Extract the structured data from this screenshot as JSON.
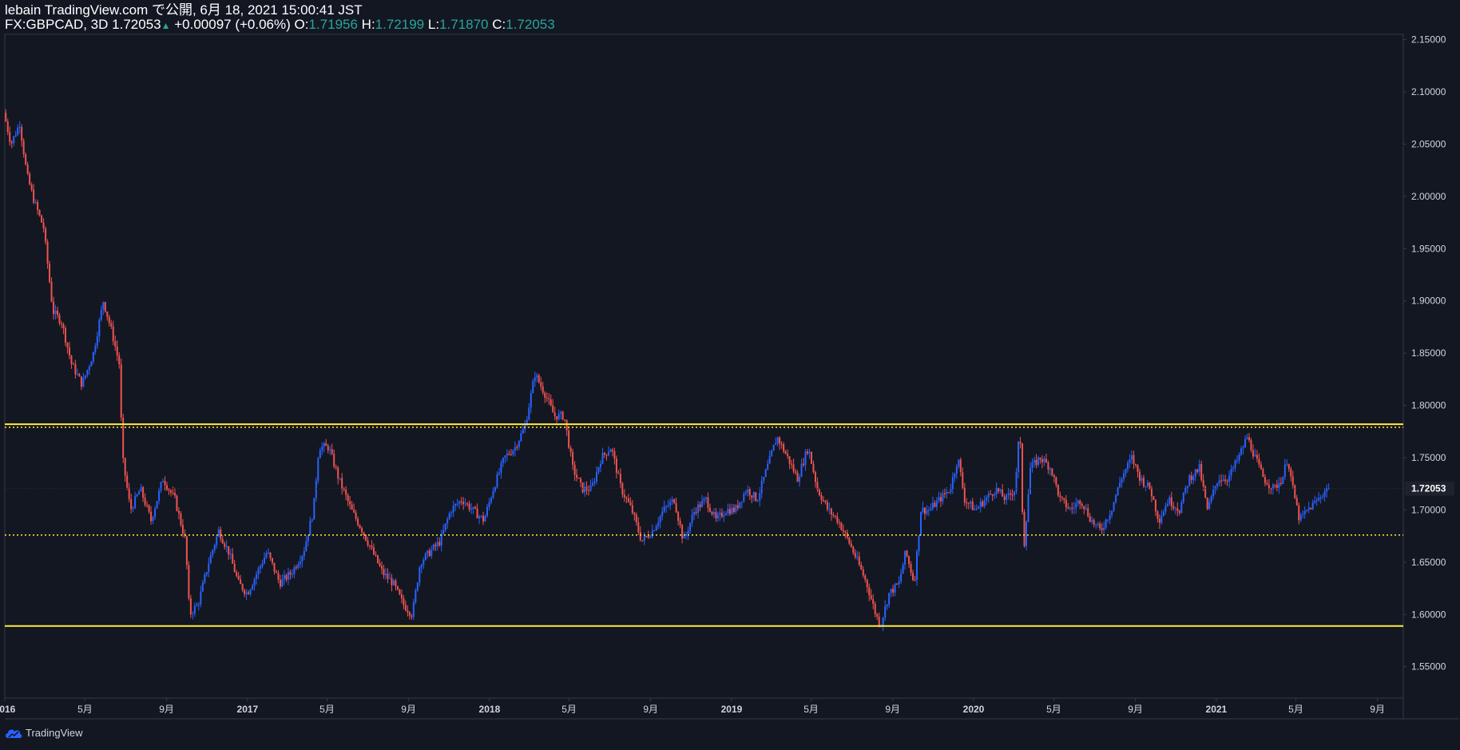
{
  "header": {
    "publish_text": "lebain TradingView.com で公開, 6月 18, 2021 15:00:41 JST",
    "symbol": "FX:GBPCAD, 3D",
    "last": "1.72053",
    "up_arrow": "▲",
    "change": "+0.00097 (+0.06%)",
    "o_label": "O:",
    "o_value": "1.71956",
    "h_label": "H:",
    "h_value": "1.72199",
    "l_label": "L:",
    "l_value": "1.71870",
    "c_label": "C:",
    "c_value": "1.72053"
  },
  "footer": {
    "brand": "TradingView",
    "logo_icon": "tradingview-cloud-icon"
  },
  "colors": {
    "background": "#131722",
    "up": "#2962ff",
    "down": "#ef5350",
    "level_line": "#ffeb3b",
    "axis_text": "#d1d4dc",
    "grid": "#363a45",
    "price_badge": "#1e222d"
  },
  "chart_data": {
    "type": "candlestick",
    "symbol": "FX:GBPCAD",
    "timeframe": "3D",
    "ylim": [
      1.52,
      2.155
    ],
    "y_ticks": [
      {
        "value": 2.15,
        "label": "2.15000"
      },
      {
        "value": 2.1,
        "label": "2.10000"
      },
      {
        "value": 2.05,
        "label": "2.05000"
      },
      {
        "value": 2.0,
        "label": "2.00000"
      },
      {
        "value": 1.95,
        "label": "1.95000"
      },
      {
        "value": 1.9,
        "label": "1.90000"
      },
      {
        "value": 1.85,
        "label": "1.85000"
      },
      {
        "value": 1.8,
        "label": "1.80000"
      },
      {
        "value": 1.75,
        "label": "1.75000"
      },
      {
        "value": 1.7,
        "label": "1.70000"
      },
      {
        "value": 1.65,
        "label": "1.65000"
      },
      {
        "value": 1.6,
        "label": "1.60000"
      },
      {
        "value": 1.55,
        "label": "1.55000"
      }
    ],
    "x_range": [
      "2016-01-01",
      "2021-10-10"
    ],
    "x_ticks": [
      {
        "date": "2016-01-01",
        "label": "2016",
        "bold": true
      },
      {
        "date": "2016-05-01",
        "label": "5月",
        "bold": false
      },
      {
        "date": "2016-09-01",
        "label": "9月",
        "bold": false
      },
      {
        "date": "2017-01-01",
        "label": "2017",
        "bold": true
      },
      {
        "date": "2017-05-01",
        "label": "5月",
        "bold": false
      },
      {
        "date": "2017-09-01",
        "label": "9月",
        "bold": false
      },
      {
        "date": "2018-01-01",
        "label": "2018",
        "bold": true
      },
      {
        "date": "2018-05-01",
        "label": "5月",
        "bold": false
      },
      {
        "date": "2018-09-01",
        "label": "9月",
        "bold": false
      },
      {
        "date": "2019-01-01",
        "label": "2019",
        "bold": true
      },
      {
        "date": "2019-05-01",
        "label": "5月",
        "bold": false
      },
      {
        "date": "2019-09-01",
        "label": "9月",
        "bold": false
      },
      {
        "date": "2020-01-01",
        "label": "2020",
        "bold": true
      },
      {
        "date": "2020-05-01",
        "label": "5月",
        "bold": false
      },
      {
        "date": "2020-09-01",
        "label": "9月",
        "bold": false
      },
      {
        "date": "2021-01-01",
        "label": "2021",
        "bold": true
      },
      {
        "date": "2021-05-01",
        "label": "5月",
        "bold": false
      },
      {
        "date": "2021-09-01",
        "label": "9月",
        "bold": false
      }
    ],
    "last_price": {
      "value": 1.72053,
      "label": "1.72053"
    },
    "horizontal_lines": [
      {
        "value": 1.782,
        "style": "solid"
      },
      {
        "value": 1.779,
        "style": "dotted"
      },
      {
        "value": 1.676,
        "style": "dotted"
      },
      {
        "value": 1.589,
        "style": "solid"
      }
    ],
    "price_path": [
      [
        "2016-01-01",
        2.08
      ],
      [
        "2016-01-12",
        2.05
      ],
      [
        "2016-01-25",
        2.07
      ],
      [
        "2016-02-05",
        2.02
      ],
      [
        "2016-02-16",
        1.995
      ],
      [
        "2016-03-01",
        1.97
      ],
      [
        "2016-03-15",
        1.89
      ],
      [
        "2016-03-28",
        1.88
      ],
      [
        "2016-04-12",
        1.84
      ],
      [
        "2016-04-28",
        1.82
      ],
      [
        "2016-05-15",
        1.85
      ],
      [
        "2016-05-30",
        1.9
      ],
      [
        "2016-06-12",
        1.87
      ],
      [
        "2016-06-23",
        1.84
      ],
      [
        "2016-06-28",
        1.75
      ],
      [
        "2016-07-10",
        1.7
      ],
      [
        "2016-07-25",
        1.72
      ],
      [
        "2016-08-10",
        1.69
      ],
      [
        "2016-08-28",
        1.73
      ],
      [
        "2016-09-15",
        1.71
      ],
      [
        "2016-10-01",
        1.67
      ],
      [
        "2016-10-07",
        1.6
      ],
      [
        "2016-10-20",
        1.61
      ],
      [
        "2016-11-05",
        1.65
      ],
      [
        "2016-11-20",
        1.68
      ],
      [
        "2016-12-05",
        1.66
      ],
      [
        "2016-12-20",
        1.63
      ],
      [
        "2017-01-02",
        1.62
      ],
      [
        "2017-01-17",
        1.64
      ],
      [
        "2017-02-01",
        1.66
      ],
      [
        "2017-02-20",
        1.63
      ],
      [
        "2017-03-10",
        1.64
      ],
      [
        "2017-03-28",
        1.66
      ],
      [
        "2017-04-12",
        1.7
      ],
      [
        "2017-04-20",
        1.76
      ],
      [
        "2017-05-05",
        1.76
      ],
      [
        "2017-05-20",
        1.73
      ],
      [
        "2017-06-08",
        1.7
      ],
      [
        "2017-06-25",
        1.68
      ],
      [
        "2017-07-10",
        1.66
      ],
      [
        "2017-07-25",
        1.64
      ],
      [
        "2017-08-10",
        1.63
      ],
      [
        "2017-08-25",
        1.61
      ],
      [
        "2017-09-08",
        1.6
      ],
      [
        "2017-09-20",
        1.65
      ],
      [
        "2017-10-05",
        1.66
      ],
      [
        "2017-10-20",
        1.67
      ],
      [
        "2017-11-05",
        1.7
      ],
      [
        "2017-11-22",
        1.71
      ],
      [
        "2017-12-08",
        1.7
      ],
      [
        "2017-12-25",
        1.69
      ],
      [
        "2018-01-08",
        1.72
      ],
      [
        "2018-01-25",
        1.75
      ],
      [
        "2018-02-10",
        1.76
      ],
      [
        "2018-02-25",
        1.78
      ],
      [
        "2018-03-12",
        1.83
      ],
      [
        "2018-03-28",
        1.81
      ],
      [
        "2018-04-10",
        1.79
      ],
      [
        "2018-04-25",
        1.79
      ],
      [
        "2018-05-08",
        1.74
      ],
      [
        "2018-05-22",
        1.72
      ],
      [
        "2018-06-05",
        1.72
      ],
      [
        "2018-06-20",
        1.75
      ],
      [
        "2018-07-05",
        1.76
      ],
      [
        "2018-07-20",
        1.72
      ],
      [
        "2018-08-05",
        1.7
      ],
      [
        "2018-08-20",
        1.67
      ],
      [
        "2018-09-05",
        1.68
      ],
      [
        "2018-09-22",
        1.7
      ],
      [
        "2018-10-08",
        1.71
      ],
      [
        "2018-10-22",
        1.67
      ],
      [
        "2018-11-08",
        1.7
      ],
      [
        "2018-11-25",
        1.71
      ],
      [
        "2018-12-10",
        1.69
      ],
      [
        "2018-12-25",
        1.7
      ],
      [
        "2019-01-08",
        1.7
      ],
      [
        "2019-01-25",
        1.72
      ],
      [
        "2019-02-10",
        1.71
      ],
      [
        "2019-02-25",
        1.74
      ],
      [
        "2019-03-12",
        1.77
      ],
      [
        "2019-03-28",
        1.75
      ],
      [
        "2019-04-12",
        1.73
      ],
      [
        "2019-04-28",
        1.76
      ],
      [
        "2019-05-12",
        1.72
      ],
      [
        "2019-05-28",
        1.7
      ],
      [
        "2019-06-12",
        1.69
      ],
      [
        "2019-06-28",
        1.67
      ],
      [
        "2019-07-12",
        1.65
      ],
      [
        "2019-07-25",
        1.63
      ],
      [
        "2019-08-08",
        1.6
      ],
      [
        "2019-08-15",
        1.59
      ],
      [
        "2019-08-28",
        1.62
      ],
      [
        "2019-09-12",
        1.63
      ],
      [
        "2019-09-22",
        1.66
      ],
      [
        "2019-10-05",
        1.63
      ],
      [
        "2019-10-15",
        1.7
      ],
      [
        "2019-10-28",
        1.7
      ],
      [
        "2019-11-12",
        1.71
      ],
      [
        "2019-11-28",
        1.72
      ],
      [
        "2019-12-10",
        1.75
      ],
      [
        "2019-12-20",
        1.71
      ],
      [
        "2020-01-05",
        1.7
      ],
      [
        "2020-01-20",
        1.71
      ],
      [
        "2020-02-05",
        1.72
      ],
      [
        "2020-02-20",
        1.71
      ],
      [
        "2020-03-05",
        1.72
      ],
      [
        "2020-03-12",
        1.78
      ],
      [
        "2020-03-18",
        1.66
      ],
      [
        "2020-03-28",
        1.74
      ],
      [
        "2020-04-12",
        1.75
      ],
      [
        "2020-04-28",
        1.74
      ],
      [
        "2020-05-12",
        1.71
      ],
      [
        "2020-05-28",
        1.7
      ],
      [
        "2020-06-12",
        1.71
      ],
      [
        "2020-06-28",
        1.69
      ],
      [
        "2020-07-12",
        1.68
      ],
      [
        "2020-07-28",
        1.7
      ],
      [
        "2020-08-12",
        1.73
      ],
      [
        "2020-08-28",
        1.75
      ],
      [
        "2020-09-10",
        1.73
      ],
      [
        "2020-09-25",
        1.72
      ],
      [
        "2020-10-08",
        1.69
      ],
      [
        "2020-10-22",
        1.71
      ],
      [
        "2020-11-08",
        1.7
      ],
      [
        "2020-11-22",
        1.73
      ],
      [
        "2020-12-08",
        1.74
      ],
      [
        "2020-12-20",
        1.7
      ],
      [
        "2021-01-05",
        1.73
      ],
      [
        "2021-01-20",
        1.73
      ],
      [
        "2021-02-05",
        1.75
      ],
      [
        "2021-02-18",
        1.77
      ],
      [
        "2021-03-02",
        1.75
      ],
      [
        "2021-03-15",
        1.73
      ],
      [
        "2021-03-30",
        1.72
      ],
      [
        "2021-04-12",
        1.73
      ],
      [
        "2021-04-20",
        1.75
      ],
      [
        "2021-04-28",
        1.72
      ],
      [
        "2021-05-08",
        1.69
      ],
      [
        "2021-05-20",
        1.7
      ],
      [
        "2021-06-05",
        1.71
      ],
      [
        "2021-06-18",
        1.72053
      ]
    ]
  }
}
